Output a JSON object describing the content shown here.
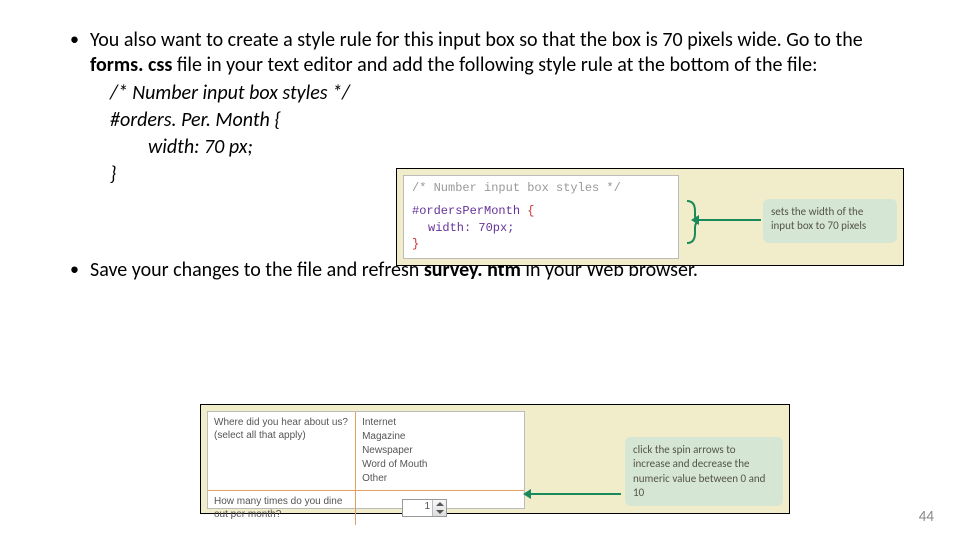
{
  "bullets": {
    "b1_pre": "You also want to create a style rule for this input box so that the box is 70 pixels wide. Go to the ",
    "b1_file": "forms. css",
    "b1_post": " file in your text editor and add the following style rule at the bottom of the file:",
    "code1": "/* Number input box styles */",
    "code2": "#orders. Per. Month {",
    "code3": "width: 70 px;",
    "code4": "}",
    "b2_pre": "Save your changes to the file and refresh ",
    "b2_file": "survey. htm",
    "b2_post": " in your Web browser."
  },
  "fig1": {
    "c1": "/* Number input box styles */",
    "c2a": "#ordersPerMonth ",
    "c2b": "{",
    "c3": "width: 70px;",
    "c4": "}",
    "note": "sets the width of the input box to 70 pixels"
  },
  "fig2": {
    "label1a": "Where did you hear about us?",
    "label1b": "(select all that apply)",
    "opt1": "Internet",
    "opt2": "Magazine",
    "opt3": "Newspaper",
    "opt4": "Word of Mouth",
    "opt5": "Other",
    "label2": "How many times do you dine out per month?",
    "numval": "1",
    "note": "click the spin arrows to increase and decrease the numeric value between 0 and 10"
  },
  "page": "44"
}
